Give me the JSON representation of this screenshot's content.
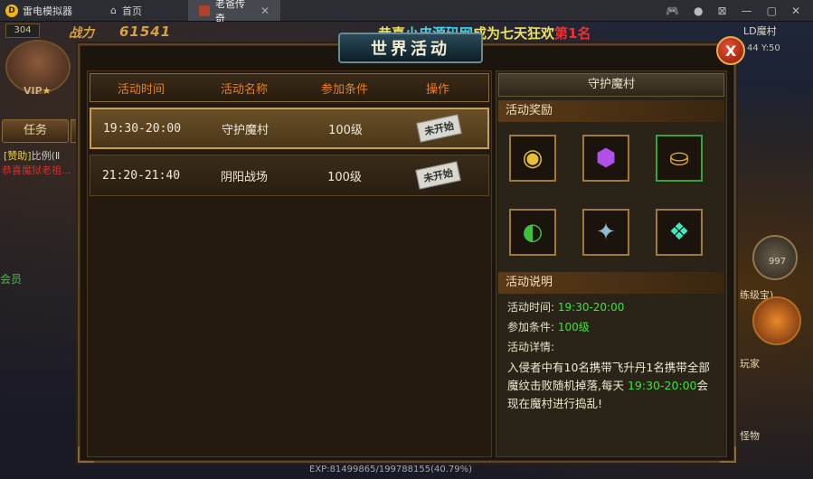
{
  "emulator": {
    "app_name": "雷电模拟器",
    "tabs": [
      {
        "label": "首页",
        "active": false
      },
      {
        "label": "老爸传奇",
        "active": true
      }
    ],
    "controls": [
      "🎮",
      "●",
      "⊠",
      "—",
      "▢",
      "✕"
    ]
  },
  "hud": {
    "level": "304",
    "power_label": "战力",
    "power_value": "61541",
    "vip": "VIP",
    "task_button": "任务",
    "chat_tag": "[赞助]",
    "chat_line": "比例(Ⅱ",
    "system_line": "恭喜魔狱老祖...",
    "left_side_text": "会员",
    "location": "LD魔村",
    "coords": "44 Y:50",
    "right_num": "997",
    "train_label": "练级宝)",
    "player_label": "玩家",
    "monster_label": "怪物",
    "exp_text": "EXP:81499865/199788155(40.79%)"
  },
  "marquee": {
    "prefix": "恭喜",
    "site": "小皮源码网",
    "middle": "成为七天狂欢",
    "rank": "第1名"
  },
  "dialog": {
    "title": "世界活动",
    "close_label": "X",
    "columns": [
      "活动时间",
      "活动名称",
      "参加条件",
      "操作"
    ],
    "rows": [
      {
        "time": "19:30-20:00",
        "name": "守护魔村",
        "condition": "100级",
        "status": "未开始",
        "selected": true
      },
      {
        "time": "21:20-21:40",
        "name": "阴阳战场",
        "condition": "100级",
        "status": "未开始",
        "selected": false
      }
    ],
    "detail": {
      "title": "守护魔村",
      "rewards_heading": "活动奖励",
      "rewards": [
        {
          "icon": "gold-coin-icon",
          "glyph": "◉",
          "color": "r-gold"
        },
        {
          "icon": "purple-gem-icon",
          "glyph": "⬢",
          "color": "r-purple"
        },
        {
          "icon": "gold-ingot-icon",
          "glyph": "⛀",
          "color": "r-ingot",
          "green_border": true
        },
        {
          "icon": "green-orb-icon",
          "glyph": "◐",
          "color": "r-green"
        },
        {
          "icon": "crystal-staff-icon",
          "glyph": "✦",
          "color": "r-staff"
        },
        {
          "icon": "teal-crystal-icon",
          "glyph": "❖",
          "color": "r-teal"
        }
      ],
      "desc_heading": "活动说明",
      "time_label": "活动时间:",
      "time_value": "19:30-20:00",
      "condition_label": "参加条件:",
      "condition_value": "100级",
      "details_label": "活动详情:",
      "details_text_1": "入侵者中有10名携带飞升丹1名携带全部魔纹击败随机掉落,每天 ",
      "details_time": "19:30-20:00",
      "details_text_2": "会现在魔村进行捣乱!"
    }
  }
}
